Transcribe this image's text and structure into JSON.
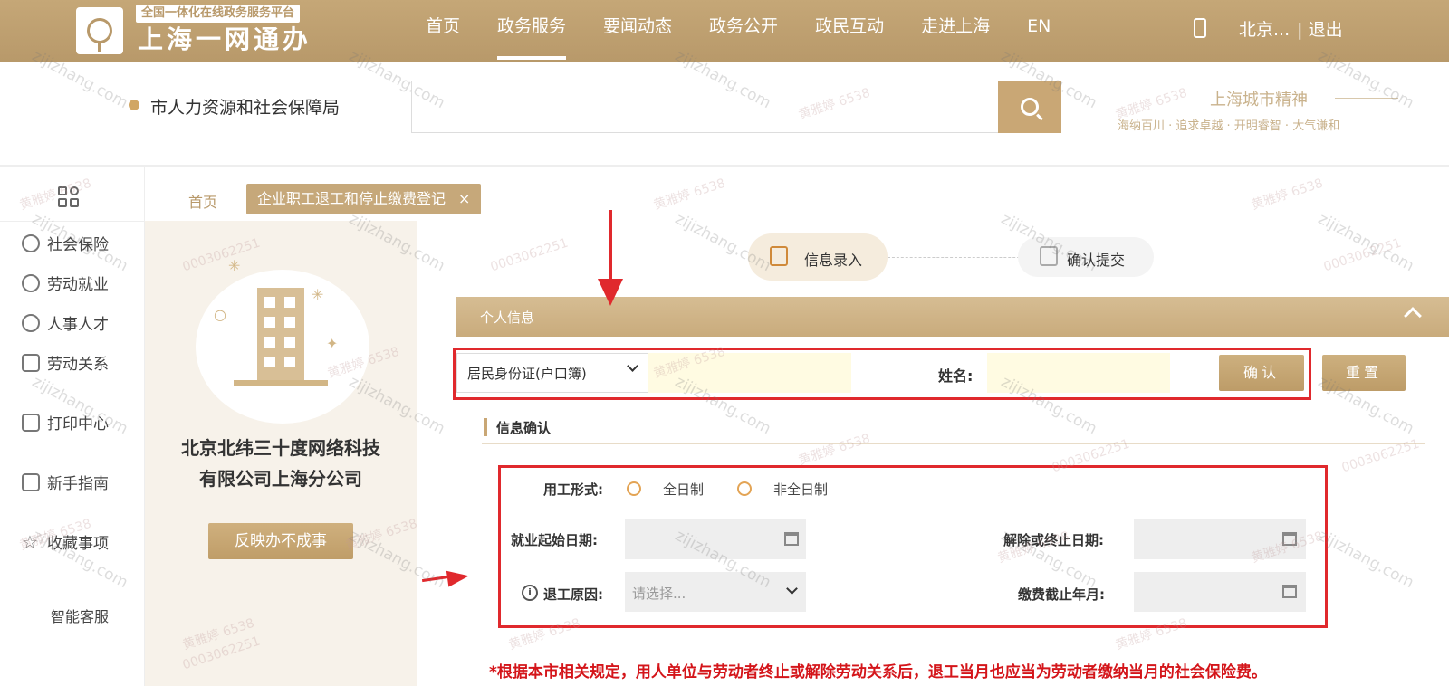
{
  "header": {
    "platform_tag": "全国一体化在线政务服务平台",
    "logo_title": "上海一网通办",
    "nav": [
      "首页",
      "政务服务",
      "要闻动态",
      "政务公开",
      "政民互动",
      "走进上海",
      "EN"
    ],
    "user_name": "北京...",
    "logout": "| 退出"
  },
  "search": {
    "org_name": "市人力资源和社会保障局",
    "placeholder": ""
  },
  "slogan": {
    "title": "上海城市精神",
    "sub": "海纳百川 · 追求卓越 · 开明睿智 · 大气谦和"
  },
  "sidebar": {
    "items": [
      "社会保险",
      "劳动就业",
      "人事人才",
      "劳动关系",
      "打印中心",
      "新手指南",
      "收藏事项"
    ],
    "service": "智能客服"
  },
  "breadcrumb": {
    "home": "首页",
    "tab": "企业职工退工和停止缴费登记",
    "close": "×"
  },
  "company": {
    "name_line1": "北京北纬三十度网络科技",
    "name_line2": "有限公司上海分公司",
    "feedback": "反映办不成事"
  },
  "steps": {
    "step1": "信息录入",
    "step2": "确认提交"
  },
  "section": {
    "title": "个人信息"
  },
  "id_form": {
    "id_type": "居民身份证(户口簿)",
    "name_label": "姓名:",
    "confirm": "确认",
    "reset": "重置"
  },
  "info": {
    "title": "信息确认",
    "employment_label": "用工形式:",
    "full_time": "全日制",
    "part_time": "非全日制",
    "start_label": "就业起始日期:",
    "end_label": "解除或终止日期:",
    "reason_label": "退工原因:",
    "reason_placeholder": "请选择...",
    "pay_label": "缴费截止年月:"
  },
  "note": "*根据本市相关规定，用人单位与劳动者终止或解除劳动关系后，退工当月也应当为劳动者缴纳当月的社会保险费。",
  "watermarks": {
    "site": "zijizhang.com",
    "name": "黄雅婷 6538",
    "code": "0003062251"
  },
  "colors": {
    "gold": "#c6a87a",
    "highlight_red": "#e0292d",
    "note_red": "#d4151a",
    "input_yellow": "#fffbe2"
  }
}
